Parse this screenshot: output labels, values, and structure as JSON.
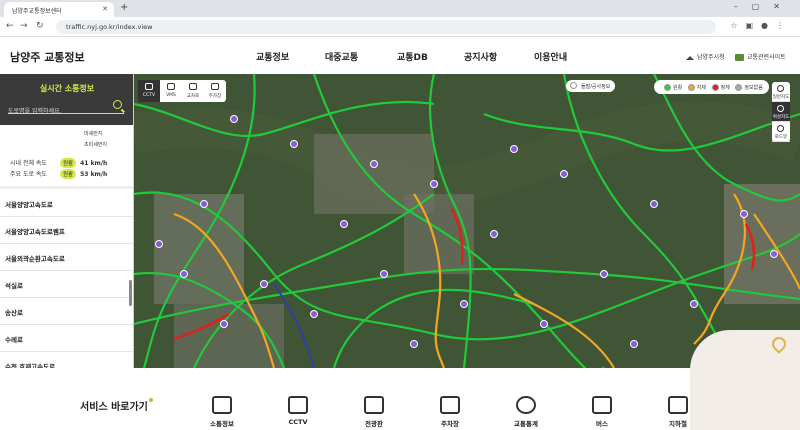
{
  "browser": {
    "tab_title": "남양주교통정보센터",
    "url": "traffic.nyj.go.kr/index.view"
  },
  "header": {
    "logo": "남양주 교통정보",
    "menu": [
      "교통정보",
      "대중교통",
      "교통DB",
      "공지사항",
      "이용안내"
    ],
    "links": [
      "남양주시청",
      "교통관련사이트"
    ]
  },
  "sidebar": {
    "title": "실시간 소통정보",
    "search_placeholder": "도로명을 입력하세요.",
    "legend": [
      "미세먼지",
      "초미세먼지"
    ],
    "speeds": [
      {
        "label": "시내 전체 속도",
        "status": "원활",
        "value": "41 km/h"
      },
      {
        "label": "주요 도로 속도",
        "status": "원활",
        "value": "53 km/h"
      }
    ],
    "roads": [
      "서울양양고속도로",
      "서울양양고속도로램프",
      "서울외곽순환고속도로",
      "석실로",
      "송산로",
      "수레로",
      "순천 호재고속도로"
    ]
  },
  "map": {
    "tools": [
      "CCTV",
      "VMS",
      "교차로",
      "주차장"
    ],
    "legend_button": "돌발/공사정보",
    "status": [
      {
        "label": "원활",
        "color": "#2ecc40"
      },
      {
        "label": "지체",
        "color": "#f5a623"
      },
      {
        "label": "정체",
        "color": "#e0201b"
      },
      {
        "label": "정보없음",
        "color": "#aaaaaa"
      }
    ],
    "side": [
      "일반지도",
      "위성지도",
      "로드뷰"
    ]
  },
  "shortcuts": {
    "title": "서비스 바로가기",
    "items": [
      "소통정보",
      "CCTV",
      "전광판",
      "주차장",
      "교통통계",
      "버스",
      "지하철"
    ]
  }
}
